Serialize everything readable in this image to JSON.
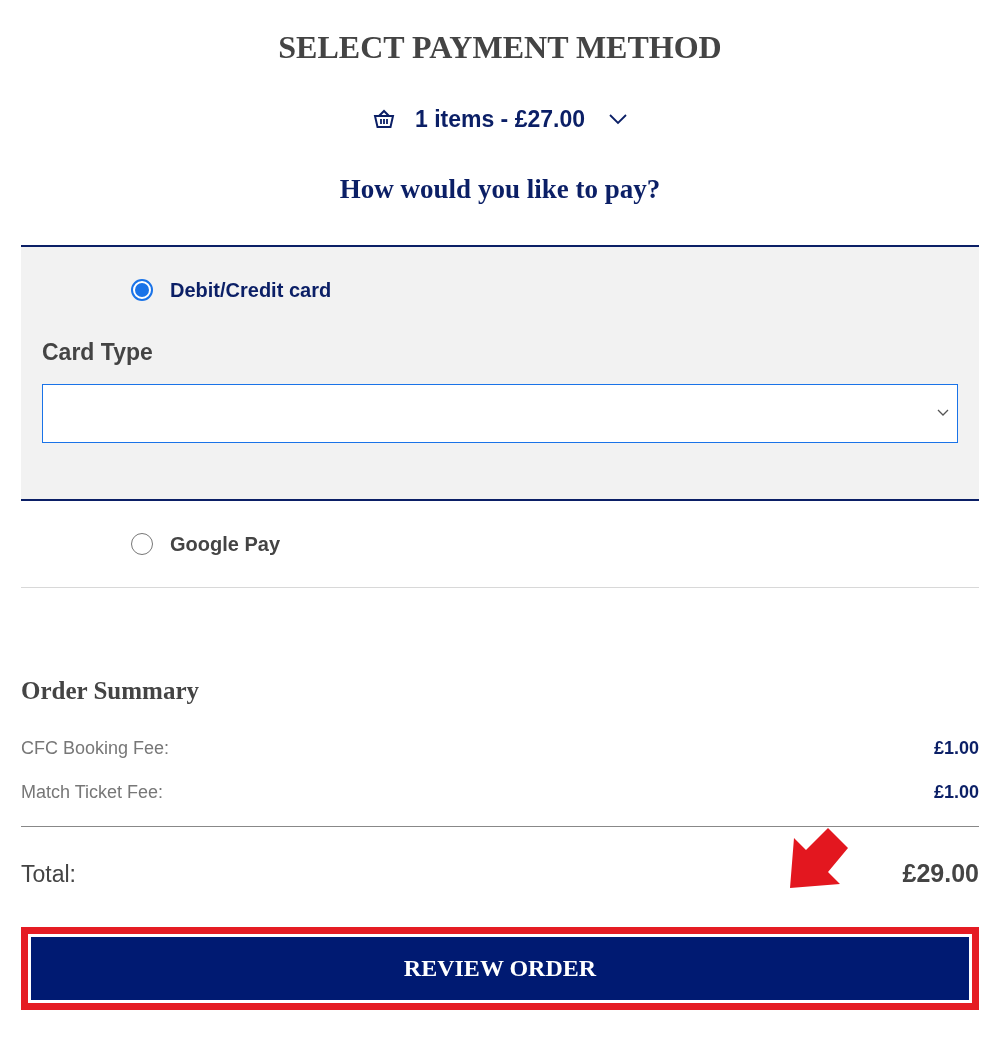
{
  "title": "SELECT PAYMENT METHOD",
  "basket": {
    "summary": "1 items - £27.00",
    "expanded": false
  },
  "question": "How would you like to pay?",
  "payment_options": [
    {
      "label": "Debit/Credit card",
      "selected": true,
      "card_type": {
        "label": "Card Type"
      }
    },
    {
      "label": "Google Pay",
      "selected": false
    }
  ],
  "order_summary": {
    "title": "Order Summary",
    "rows": [
      {
        "label": "CFC Booking Fee:",
        "value": "£1.00"
      },
      {
        "label": "Match Ticket Fee:",
        "value": "£1.00"
      }
    ],
    "total_label": "Total:",
    "total_value": "£29.00"
  },
  "button": "REVIEW ORDER"
}
